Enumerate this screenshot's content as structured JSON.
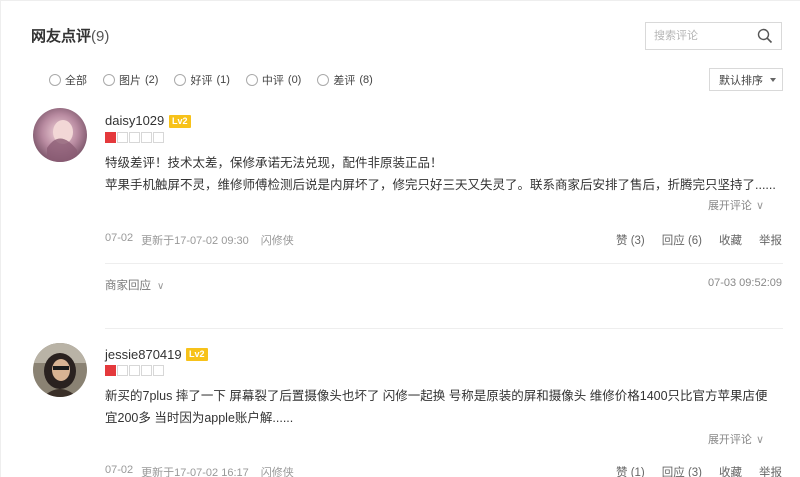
{
  "header": {
    "title": "网友点评",
    "count": "(9)",
    "search_placeholder": "搜索评论"
  },
  "filters": [
    {
      "label": "全部",
      "count": ""
    },
    {
      "label": "图片",
      "count": "(2)"
    },
    {
      "label": "好评",
      "count": "(1)"
    },
    {
      "label": "中评",
      "count": "(0)"
    },
    {
      "label": "差评",
      "count": "(8)"
    }
  ],
  "sort": {
    "label": "默认排序"
  },
  "reviews": [
    {
      "username": "daisy1029",
      "level": "Lv2",
      "rating": 1,
      "line1": "特级差评！技术太差，保修承诺无法兑现，配件非原装正品！",
      "line2": "苹果手机触屏不灵，维修师傅检测后说是内屏坏了，修完只好三天又失灵了。联系商家后安排了售后，折腾完只坚持了......",
      "expand": "展开评论",
      "date": "07-02",
      "updated": "更新于17-07-02 09:30",
      "shop": "闪修侠",
      "like": "赞 (3)",
      "reply": "回应 (6)",
      "collect": "收藏",
      "report": "举报",
      "merchant_reply": "商家回应",
      "merchant_time": "07-03 09:52:09"
    },
    {
      "username": "jessie870419",
      "level": "Lv2",
      "rating": 1,
      "line1": "新买的7plus 摔了一下 屏幕裂了后置摄像头也坏了 闪修一起换 号称是原装的屏和摄像头 维修价格1400只比官方苹果店便",
      "line2": "宜200多 当时因为apple账户解......",
      "expand": "展开评论",
      "date": "07-02",
      "updated": "更新于17-07-02 16:17",
      "shop": "闪修侠",
      "like": "赞 (1)",
      "reply": "回应 (3)",
      "collect": "收藏",
      "report": "举报"
    }
  ],
  "colors": {
    "level_badge": "#f7c21a",
    "star_on": "#e4393c"
  }
}
